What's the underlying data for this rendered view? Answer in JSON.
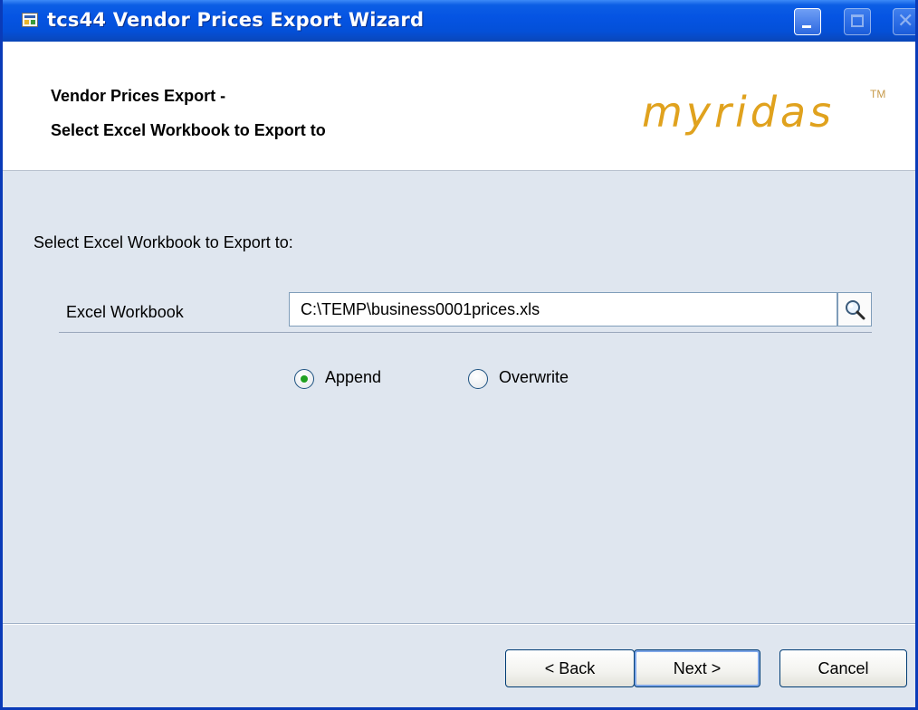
{
  "window": {
    "title": "tcs44 Vendor Prices Export Wizard",
    "close_glyph": "✕"
  },
  "header": {
    "line1": "Vendor Prices Export -",
    "line2": "Select Excel Workbook to Export to",
    "logo": "myridas",
    "trademark": "TM"
  },
  "form": {
    "prompt": "Select Excel Workbook to Export to:",
    "field_label": "Excel Workbook",
    "path_value": "C:\\TEMP\\business0001prices.xls",
    "browse_icon": "magnifier-icon",
    "options": [
      {
        "label": "Append",
        "selected": true
      },
      {
        "label": "Overwrite",
        "selected": false
      }
    ]
  },
  "buttons": {
    "back": "< Back",
    "next": "Next >",
    "cancel": "Cancel"
  },
  "colors": {
    "titlebar": "#0554e3",
    "body_bg": "#dfe6ef",
    "logo": "#e0a21e",
    "radio_selected": "#21a121"
  }
}
